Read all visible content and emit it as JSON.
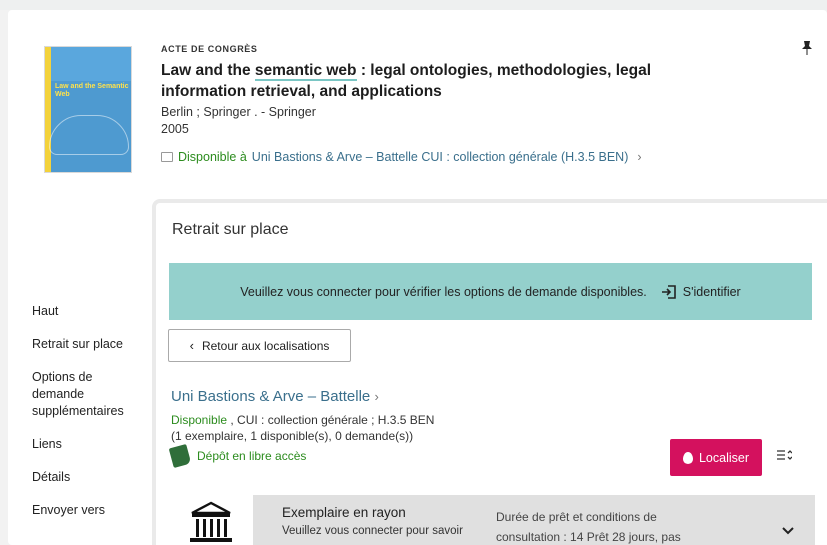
{
  "record": {
    "doc_type": "ACTE DE CONGRÈS",
    "title_before": "Law and the ",
    "title_highlight": "semantic web",
    "title_after": " : legal ontologies, methodologies, legal information retrieval, and applications",
    "publisher": "Berlin ; Springer . - Springer",
    "year": "2005",
    "availability_status": "Disponible à",
    "availability_location": "Uni Bastions & Arve – Battelle  CUI : collection générale (H.3.5 BEN)",
    "cover_text": "Law and the Semantic Web"
  },
  "nav": {
    "items": [
      "Haut",
      "Retrait sur place",
      "Options de demande supplémentaires",
      "Liens",
      "Détails",
      "Envoyer vers"
    ]
  },
  "panel": {
    "title": "Retrait sur place",
    "banner_text": "Veuillez vous connecter pour vérifier les options de demande disponibles.",
    "login_label": "S'identifier",
    "back_label": "Retour aux localisations",
    "location_name": "Uni Bastions & Arve – Battelle",
    "location_status": "Disponible",
    "location_detail": " , CUI : collection générale ; H.3.5 BEN",
    "location_counts": "(1 exemplaire, 1 disponible(s), 0 demande(s))",
    "depot_label": "Dépôt en libre accès",
    "localiser_label": "Localiser",
    "item_title": "Exemplaire en rayon",
    "item_sub": "Veuillez vous connecter pour savoir",
    "item_terms_1": "Durée de prêt et conditions de",
    "item_terms_2": "consultation : 14 Prêt 28 jours, pas"
  },
  "colors": {
    "banner": "#94d0cc",
    "localiser_button": "#d4115e",
    "available_green": "#2c8c1e",
    "link_blue": "#3a6f8c"
  },
  "icons": [
    "pin-icon",
    "book-icon",
    "login-icon",
    "chevron-left-icon",
    "chevron-right-icon",
    "depot-icon",
    "location-pin-icon",
    "sort-icon",
    "library-icon",
    "chevron-down-icon"
  ]
}
